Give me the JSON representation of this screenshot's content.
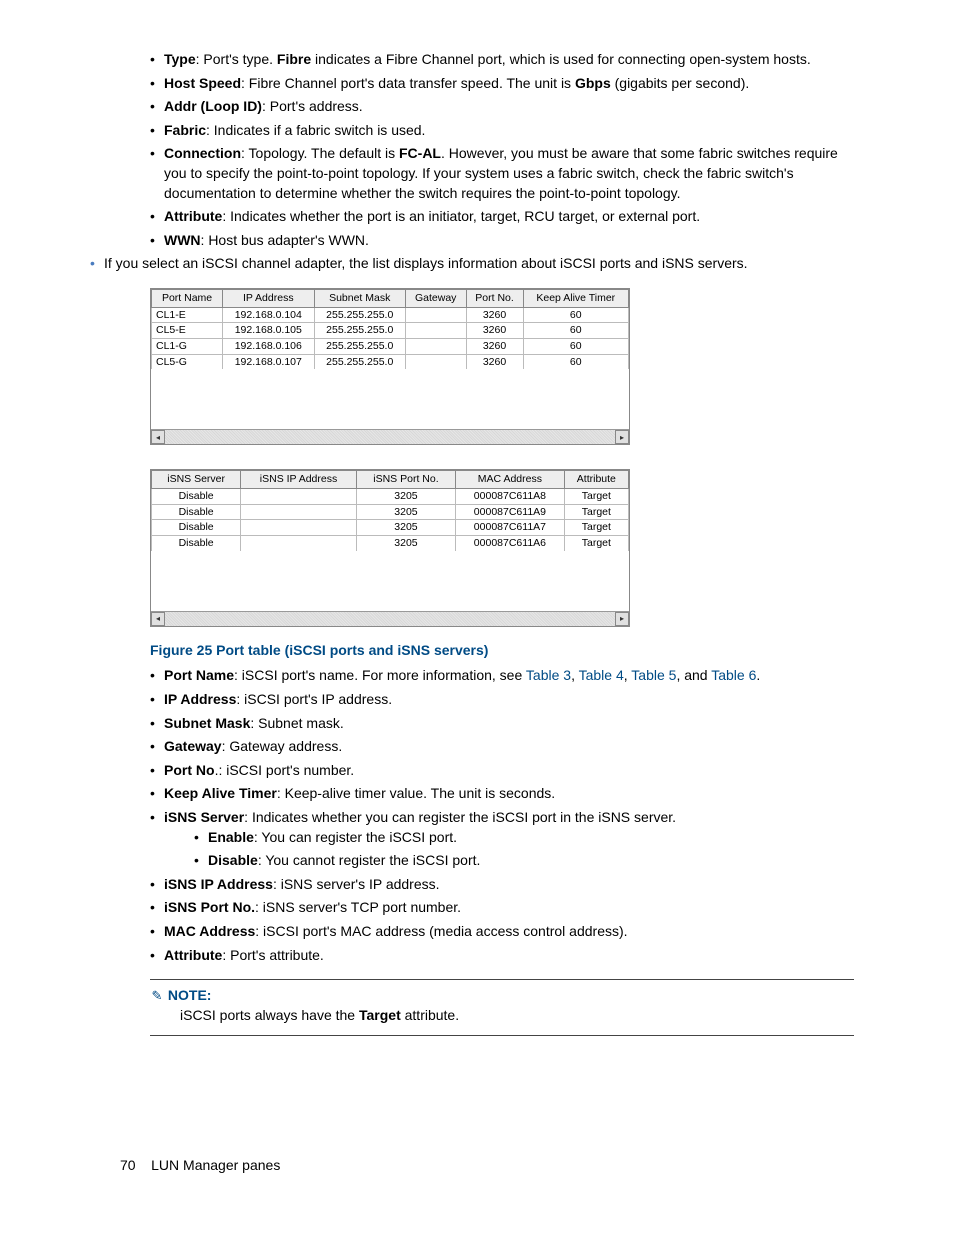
{
  "top_text": "If you select an iSCSI channel adapter, the list displays information about iSCSI ports and iSNS servers.",
  "defs1": {
    "type_lbl": "Type",
    "type_txt": ": Port's type. ",
    "fibre": "Fibre",
    "type_rest": " indicates a Fibre Channel port, which is used for connecting open-system hosts.",
    "hs_lbl": "Host Speed",
    "hs_txt": ": Fibre Channel port's data transfer speed. The unit is ",
    "gbps": "Gbps",
    "hs_rest": " (gigabits per second).",
    "addr_lbl": "Addr (Loop ID)",
    "addr_txt": ": Port's address.",
    "fabric_lbl": "Fabric",
    "fabric_txt": ": Indicates if a fabric switch is used.",
    "conn_lbl": "Connection",
    "conn_txt1": ": Topology. The default is ",
    "fcal": "FC-AL",
    "conn_txt2": ". However, you must be aware that some fabric switches require you to specify the point-to-point topology. If your system uses a fabric switch, check the fabric switch's documentation to determine whether the switch requires the point-to-point topology.",
    "attr_lbl": "Attribute",
    "attr_txt": ": Indicates whether the port is an initiator, target, RCU target, or external port.",
    "wwn_lbl": "WWN",
    "wwn_txt": ": Host bus adapter's WWN."
  },
  "table1": {
    "headers": [
      "Port Name",
      "IP Address",
      "Subnet Mask",
      "Gateway",
      "Port No.",
      "Keep Alive Timer"
    ],
    "rows": [
      [
        "CL1-E",
        "192.168.0.104",
        "255.255.255.0",
        "",
        "3260",
        "60"
      ],
      [
        "CL5-E",
        "192.168.0.105",
        "255.255.255.0",
        "",
        "3260",
        "60"
      ],
      [
        "CL1-G",
        "192.168.0.106",
        "255.255.255.0",
        "",
        "3260",
        "60"
      ],
      [
        "CL5-G",
        "192.168.0.107",
        "255.255.255.0",
        "",
        "3260",
        "60"
      ]
    ]
  },
  "table2": {
    "headers": [
      "iSNS Server",
      "iSNS IP Address",
      "iSNS Port No.",
      "MAC Address",
      "Attribute"
    ],
    "rows": [
      [
        "Disable",
        "",
        "3205",
        "000087C611A8",
        "Target"
      ],
      [
        "Disable",
        "",
        "3205",
        "000087C611A9",
        "Target"
      ],
      [
        "Disable",
        "",
        "3205",
        "000087C611A7",
        "Target"
      ],
      [
        "Disable",
        "",
        "3205",
        "000087C611A6",
        "Target"
      ]
    ]
  },
  "fig_caption": "Figure 25 Port table (iSCSI ports and iSNS servers)",
  "defs2": {
    "pn_lbl": "Port Name",
    "pn_txt": ": iSCSI port's name. For more information, see ",
    "t3": "Table 3",
    "c1": ", ",
    "t4": "Table 4",
    "c2": ", ",
    "t5": "Table 5",
    "c3": ", and ",
    "t6": "Table 6",
    "dot": ".",
    "ip_lbl": "IP Address",
    "ip_txt": ": iSCSI port's IP address.",
    "sm_lbl": "Subnet Mask",
    "sm_txt": ": Subnet mask.",
    "gw_lbl": "Gateway",
    "gw_txt": ": Gateway address.",
    "pno_lbl": "Port No",
    "pno_txt": ".: iSCSI port's number.",
    "kat_lbl": "Keep Alive Timer",
    "kat_txt": ": Keep-alive timer value. The unit is seconds.",
    "isns_lbl": "iSNS Server",
    "isns_txt": ": Indicates whether you can register the iSCSI port in the iSNS server.",
    "en_lbl": "Enable",
    "en_txt": ":  You can register the iSCSI port.",
    "dis_lbl": "Disable",
    "dis_txt": ":  You cannot register the iSCSI port.",
    "iip_lbl": "iSNS IP Address",
    "iip_txt": ": iSNS server's IP address.",
    "ipn_lbl": "iSNS Port No.",
    "ipn_txt": ": iSNS server's TCP port number.",
    "mac_lbl": "MAC Address",
    "mac_txt": ": iSCSI port's MAC address (media access control address).",
    "at_lbl": "Attribute",
    "at_txt": ": Port's attribute."
  },
  "note_label": "NOTE:",
  "note_before": "iSCSI ports always have the ",
  "note_bold": "Target",
  "note_after": " attribute.",
  "page_no": "70",
  "page_title": "LUN Manager panes"
}
